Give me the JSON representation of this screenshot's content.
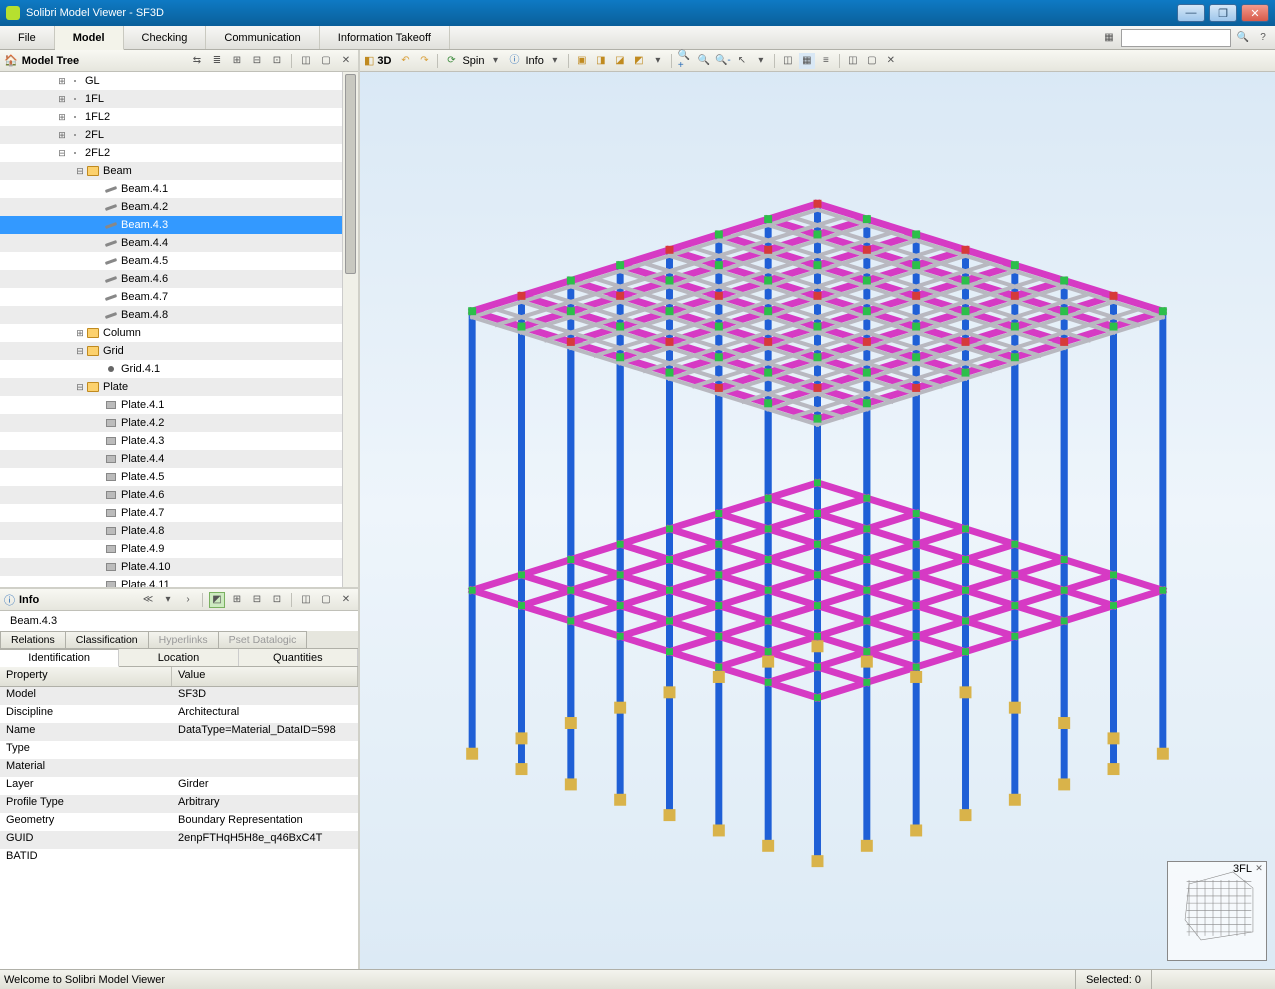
{
  "title": "Solibri Model Viewer - SF3D",
  "menu": [
    "File",
    "Model",
    "Checking",
    "Communication",
    "Information Takeoff"
  ],
  "activeMenu": 1,
  "modelTree": {
    "title": "Model Tree",
    "items": [
      {
        "depth": 2,
        "exp": "+",
        "icon": "level",
        "label": "GL"
      },
      {
        "depth": 2,
        "exp": "+",
        "icon": "level",
        "label": "1FL"
      },
      {
        "depth": 2,
        "exp": "+",
        "icon": "level",
        "label": "1FL2"
      },
      {
        "depth": 2,
        "exp": "+",
        "icon": "level",
        "label": "2FL"
      },
      {
        "depth": 2,
        "exp": "-",
        "icon": "level",
        "label": "2FL2"
      },
      {
        "depth": 3,
        "exp": "-",
        "icon": "folder",
        "label": "Beam"
      },
      {
        "depth": 4,
        "exp": "",
        "icon": "beam",
        "label": "Beam.4.1"
      },
      {
        "depth": 4,
        "exp": "",
        "icon": "beam",
        "label": "Beam.4.2"
      },
      {
        "depth": 4,
        "exp": "",
        "icon": "beam",
        "label": "Beam.4.3",
        "sel": true
      },
      {
        "depth": 4,
        "exp": "",
        "icon": "beam",
        "label": "Beam.4.4"
      },
      {
        "depth": 4,
        "exp": "",
        "icon": "beam",
        "label": "Beam.4.5"
      },
      {
        "depth": 4,
        "exp": "",
        "icon": "beam",
        "label": "Beam.4.6"
      },
      {
        "depth": 4,
        "exp": "",
        "icon": "beam",
        "label": "Beam.4.7"
      },
      {
        "depth": 4,
        "exp": "",
        "icon": "beam",
        "label": "Beam.4.8"
      },
      {
        "depth": 3,
        "exp": "+",
        "icon": "folder",
        "label": "Column"
      },
      {
        "depth": 3,
        "exp": "-",
        "icon": "folder",
        "label": "Grid"
      },
      {
        "depth": 4,
        "exp": "",
        "icon": "dot",
        "label": "Grid.4.1"
      },
      {
        "depth": 3,
        "exp": "-",
        "icon": "folder",
        "label": "Plate"
      },
      {
        "depth": 4,
        "exp": "",
        "icon": "plate",
        "label": "Plate.4.1"
      },
      {
        "depth": 4,
        "exp": "",
        "icon": "plate",
        "label": "Plate.4.2"
      },
      {
        "depth": 4,
        "exp": "",
        "icon": "plate",
        "label": "Plate.4.3"
      },
      {
        "depth": 4,
        "exp": "",
        "icon": "plate",
        "label": "Plate.4.4"
      },
      {
        "depth": 4,
        "exp": "",
        "icon": "plate",
        "label": "Plate.4.5"
      },
      {
        "depth": 4,
        "exp": "",
        "icon": "plate",
        "label": "Plate.4.6"
      },
      {
        "depth": 4,
        "exp": "",
        "icon": "plate",
        "label": "Plate.4.7"
      },
      {
        "depth": 4,
        "exp": "",
        "icon": "plate",
        "label": "Plate.4.8"
      },
      {
        "depth": 4,
        "exp": "",
        "icon": "plate",
        "label": "Plate.4.9"
      },
      {
        "depth": 4,
        "exp": "",
        "icon": "plate",
        "label": "Plate.4.10"
      },
      {
        "depth": 4,
        "exp": "",
        "icon": "plate",
        "label": "Plate.4.11"
      }
    ]
  },
  "info": {
    "title": "Info",
    "selected": "Beam.4.3",
    "tabs1": [
      "Relations",
      "Classification",
      "Hyperlinks",
      "Pset Datalogic"
    ],
    "tabs2": [
      "Identification",
      "Location",
      "Quantities"
    ],
    "activeTab2": 0,
    "propHdr": {
      "p": "Property",
      "v": "Value"
    },
    "props": [
      {
        "p": "Model",
        "v": "SF3D"
      },
      {
        "p": "Discipline",
        "v": "Architectural"
      },
      {
        "p": "Name",
        "v": "DataType=Material_DataID=598"
      },
      {
        "p": "Type",
        "v": ""
      },
      {
        "p": "Material",
        "v": ""
      },
      {
        "p": "Layer",
        "v": "Girder"
      },
      {
        "p": "Profile Type",
        "v": "Arbitrary"
      },
      {
        "p": "Geometry",
        "v": "Boundary Representation"
      },
      {
        "p": "GUID",
        "v": "2enpFTHqH5H8e_q46BxC4T"
      },
      {
        "p": "BATID",
        "v": ""
      }
    ]
  },
  "viewport": {
    "title": "3D",
    "spin": "Spin",
    "infoBtn": "Info",
    "minimap": "3FL"
  },
  "status": {
    "msg": "Welcome to Solibri Model Viewer",
    "sel": "Selected: 0"
  }
}
